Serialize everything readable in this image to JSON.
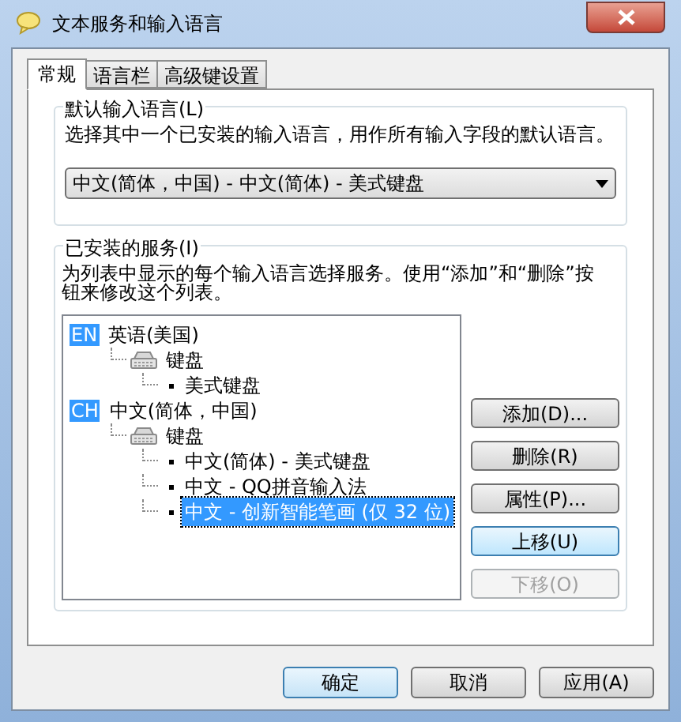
{
  "window": {
    "title": "文本服务和输入语言"
  },
  "tabs": [
    {
      "label": "常规",
      "selected": true
    },
    {
      "label": "语言栏",
      "selected": false
    },
    {
      "label": "高级键设置",
      "selected": false
    }
  ],
  "default_language": {
    "title": "默认输入语言(L)",
    "description": "选择其中一个已安装的输入语言，用作所有输入字段的默认语言。",
    "dropdown": {
      "value": "中文(简体，中国) - 中文(简体) - 美式键盘"
    }
  },
  "installed_services": {
    "title": "已安装的服务(I)",
    "description": "为列表中显示的每个输入语言选择服务。使用“添加”和“删除”按钮来修改这个列表。",
    "tree": [
      {
        "kind": "language",
        "badge": "EN",
        "label": "英语(美国)",
        "selected": false,
        "children": [
          {
            "kind": "category",
            "label": "键盘",
            "selected": false,
            "children": [
              {
                "kind": "service",
                "label": "美式键盘",
                "selected": false
              }
            ]
          }
        ]
      },
      {
        "kind": "language",
        "badge": "CH",
        "label": "中文(简体，中国)",
        "selected": false,
        "children": [
          {
            "kind": "category",
            "label": "键盘",
            "selected": false,
            "children": [
              {
                "kind": "service",
                "label": "中文(简体) - 美式键盘",
                "selected": false
              },
              {
                "kind": "service",
                "label": "中文 - QQ拼音输入法",
                "selected": false
              },
              {
                "kind": "service",
                "label": "中文 - 创新智能笔画 (仅 32 位)",
                "selected": true
              }
            ]
          }
        ]
      }
    ]
  },
  "side_buttons": [
    {
      "label": "添加(D)...",
      "disabled": false,
      "highlighted": false
    },
    {
      "label": "删除(R)",
      "disabled": false,
      "highlighted": false
    },
    {
      "label": "属性(P)...",
      "disabled": false,
      "highlighted": false
    },
    {
      "label": "上移(U)",
      "disabled": false,
      "highlighted": true
    },
    {
      "label": "下移(O)",
      "disabled": true,
      "highlighted": false
    }
  ],
  "footer_buttons": [
    {
      "label": "确定",
      "default": true
    },
    {
      "label": "取消",
      "default": false
    },
    {
      "label": "应用(A)",
      "default": false
    }
  ]
}
